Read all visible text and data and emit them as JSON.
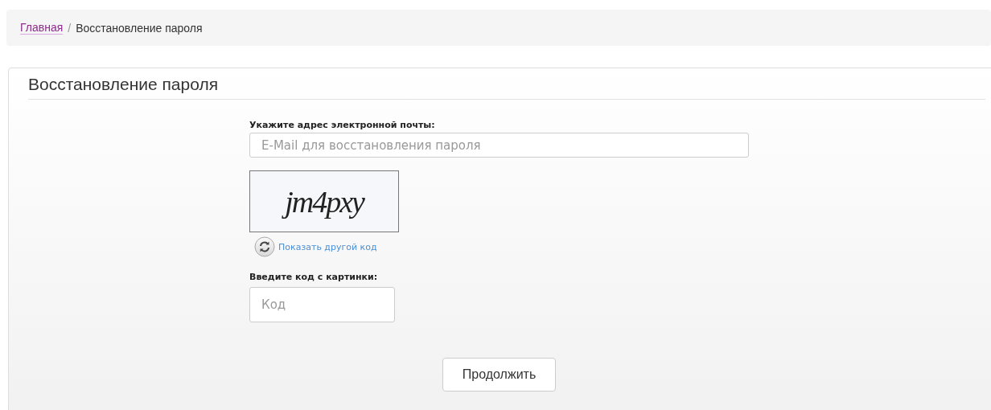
{
  "breadcrumb": [
    {
      "label": "Главная",
      "kind": "link"
    },
    {
      "label": "Восстановление пароля",
      "kind": "current"
    }
  ],
  "breadcrumb_separator": "/",
  "panel": {
    "title": "Восстановление пароля"
  },
  "email": {
    "label": "Укажите адрес электронной почты:",
    "placeholder": "E-Mail для восстановления пароля"
  },
  "captcha": {
    "code": "jm4pxy",
    "refresh_link": "Показать другой код"
  },
  "code": {
    "label": "Введите код с картинки:",
    "placeholder": "Код"
  },
  "submit": "Продолжить"
}
